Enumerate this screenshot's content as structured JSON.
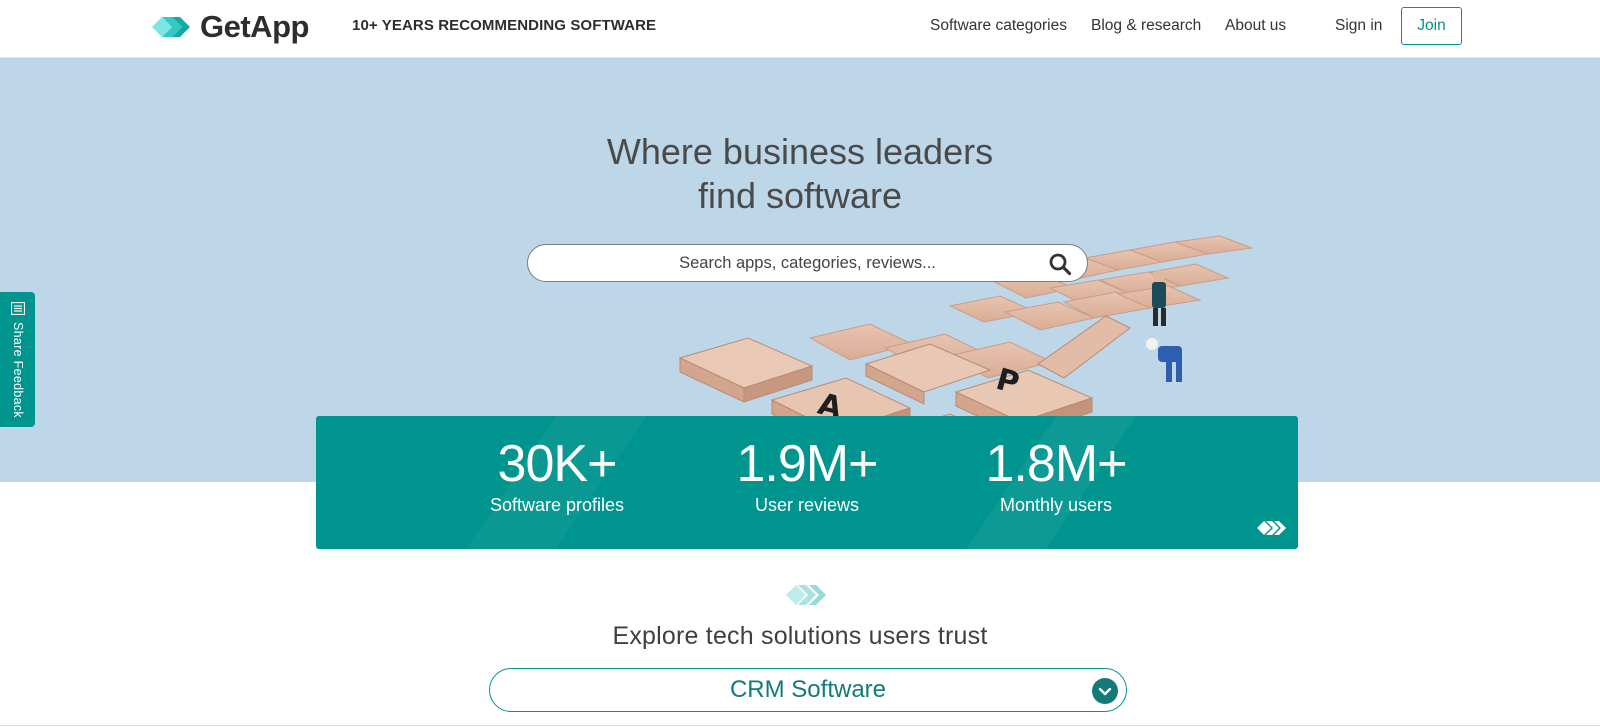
{
  "header": {
    "brand": "GetApp",
    "tagline": "10+ YEARS RECOMMENDING SOFTWARE",
    "nav": [
      "Software categories",
      "Blog & research",
      "About us"
    ],
    "sign_in": "Sign in",
    "join": "Join"
  },
  "hero": {
    "title_line1": "Where business leaders",
    "title_line2": "find software",
    "search": {
      "placeholder": "Search apps, categories, reviews...",
      "icon": "search-icon"
    }
  },
  "feedback_tab": {
    "label": "Share Feedback",
    "icon": "feedback-icon"
  },
  "stats": [
    {
      "value": "30K+",
      "label": "Software profiles"
    },
    {
      "value": "1.9M+",
      "label": "User reviews"
    },
    {
      "value": "1.8M+",
      "label": "Monthly users"
    }
  ],
  "explore": {
    "title": "Explore tech solutions users trust",
    "selected": "CRM Software",
    "icon": "chevron-down-icon"
  },
  "colors": {
    "brand_teal": "#00948f",
    "hero_bg": "#bed7e8",
    "text_dark": "#2d2d2d",
    "logo_cyan": "#4fd3d0"
  }
}
